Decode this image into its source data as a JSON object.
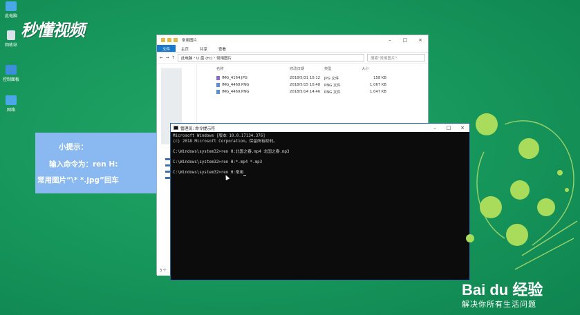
{
  "desktop": {
    "icons": [
      {
        "label": "此电脑",
        "color": "#4aa8e8"
      },
      {
        "label": "回收站",
        "color": "#d8e3ea"
      },
      {
        "label": "控制面板",
        "color": "#3c8fd8"
      },
      {
        "label": "网络",
        "color": "#4aa8e8"
      }
    ],
    "logo": "秒懂视频"
  },
  "explorer": {
    "title": "常用图片",
    "ribbon_tabs": [
      "文件",
      "主页",
      "共享",
      "查看"
    ],
    "path": [
      "此电脑",
      "U 盘 (H:)",
      "常用图片"
    ],
    "search_placeholder": "搜索\"常用图片\"",
    "columns": {
      "name": "名称",
      "date": "修改日期",
      "type": "类型",
      "size": "大小"
    },
    "files": [
      {
        "name": "IMG_4164.JPG",
        "date": "2018/5/31 10:12",
        "type": "JPG 文件",
        "size": "158 KB",
        "icon": "jpg-file-icon"
      },
      {
        "name": "IMG_4468.PNG",
        "date": "2018/5/15 10:48",
        "type": "PNG 文件",
        "size": "1,067 KB",
        "icon": "png-file-icon"
      },
      {
        "name": "IMG_4469.PNG",
        "date": "2018/5/14 14:46",
        "type": "PNG 文件",
        "size": "1,047 KB",
        "icon": "png-file-icon"
      }
    ],
    "status": "3 个"
  },
  "cmd": {
    "title": "管理员: 命令提示符",
    "lines": [
      "Microsoft Windows [版本 10.0.17134.376]",
      "(c) 2018 Microsoft Corporation。保留所有权利。",
      "",
      "C:\\Windows\\system32>ren H:北国之春.mp4 北国之春.mp3",
      "",
      "C:\\Windows\\system32>ren H:*.mp4 *.mp3",
      "",
      "C:\\Windows\\system32>ren H:常用"
    ]
  },
  "tip": {
    "line1": "小提示：",
    "line2": "输入命令为：ren H:",
    "line3": "常用图片“\\* *.jpg”回车"
  },
  "brand": {
    "baidu": "Bai du 经验",
    "slogan": "解决你所有生活问题"
  }
}
